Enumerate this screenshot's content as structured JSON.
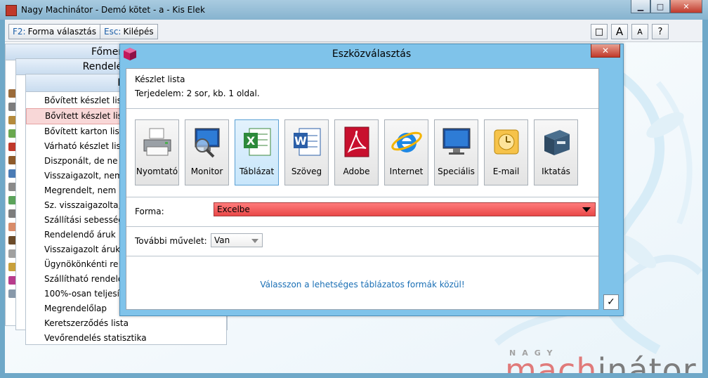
{
  "window": {
    "title": "Nagy Machinátor - Demó kötet - a - Kis Elek",
    "btn_minimize": "▁",
    "btn_maximize": "□",
    "btn_close": "✕"
  },
  "toolbar": {
    "f2_key": "F2:",
    "f2_label": "Forma választás",
    "esc_key": "Esc:",
    "esc_label": "Kilépés",
    "btn_window": "□",
    "btn_font_large": "A",
    "btn_font_small": "A",
    "btn_help": "?"
  },
  "menus": {
    "main_header": "Főmenü",
    "orders_header": "Rendelés-nyilvá",
    "lists_header": "List",
    "items": [
      "Bővített készlet lista",
      "Bővített készlet lista",
      "Bővített karton lista",
      "Várható készlet lista",
      "Diszponált, de ne",
      "Visszaigazolt, nem",
      "Megrendelt, nem",
      "Sz. visszaigazolta,",
      "Szállítási sebesség",
      "Rendelendő áruk",
      "Visszaigazolt áruk",
      "Ügynökönkénti re",
      "Szállítható rendele",
      "100%-osan teljesí",
      "Megrendelőlap",
      "Keretszerződés lista",
      "Vevőrendelés statisztika"
    ]
  },
  "dialog": {
    "title": "Eszközválasztás",
    "close": "✕",
    "list_name": "Készlet lista",
    "scope_text": "Terjedelem:  2 sor, kb.  1 oldal.",
    "tools": [
      {
        "label": "Nyomtató",
        "icon": "printer-icon"
      },
      {
        "label": "Monitor",
        "icon": "monitor-search-icon"
      },
      {
        "label": "Táblázat",
        "icon": "excel-icon",
        "active": true
      },
      {
        "label": "Szöveg",
        "icon": "word-icon"
      },
      {
        "label": "Adobe",
        "icon": "adobe-icon"
      },
      {
        "label": "Internet",
        "icon": "internet-explorer-icon"
      },
      {
        "label": "Speciális",
        "icon": "monitor-icon"
      },
      {
        "label": "E-mail",
        "icon": "mail-icon"
      },
      {
        "label": "Iktatás",
        "icon": "archive-icon"
      }
    ],
    "forma_label": "Forma:",
    "forma_value": "Excelbe",
    "further_label": "További művelet:",
    "further_value": "Van",
    "hint": "Válasszon a lehetséges táblázatos formák közül!",
    "ok": "✓"
  },
  "logo": {
    "small": "NAGY",
    "big_part1": "mach",
    "big_part2": "inátor"
  },
  "colors": {
    "accent_red": "#e94848",
    "dialog_frame": "#7fc3ea",
    "link_blue": "#1a6fb5"
  }
}
